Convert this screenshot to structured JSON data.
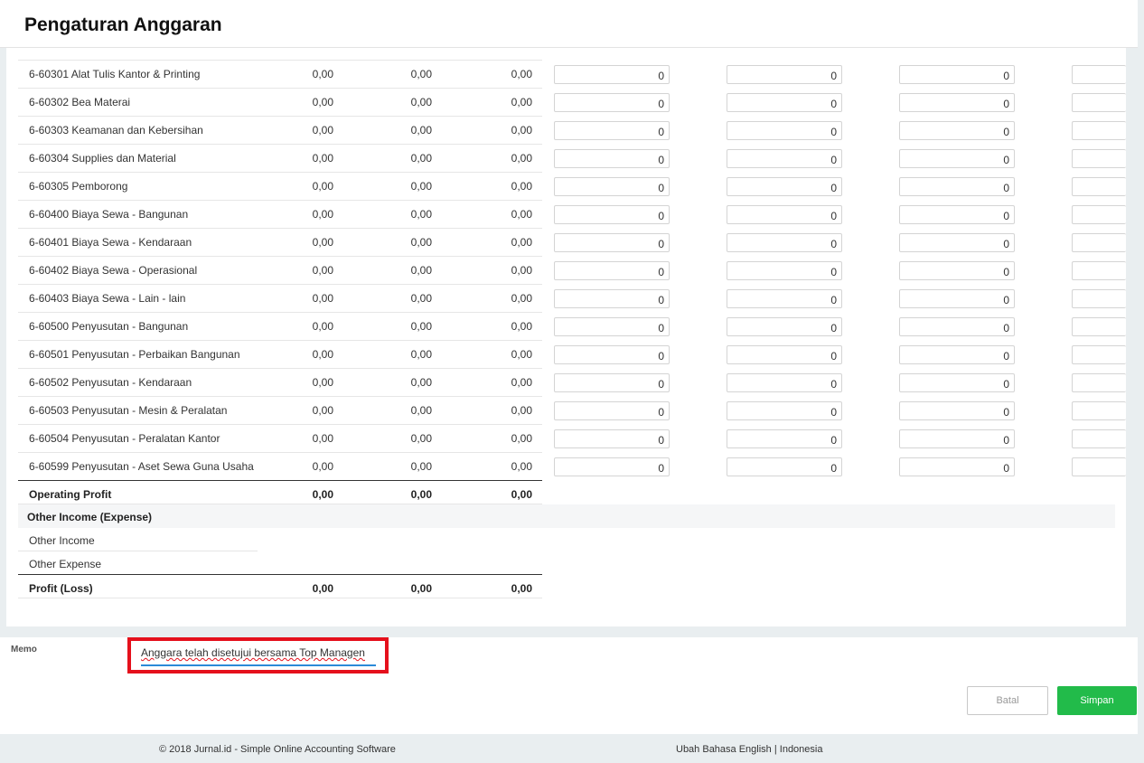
{
  "header": {
    "title": "Pengaturan Anggaran"
  },
  "accounts": [
    {
      "name": "6-60301 Alat Tulis Kantor & Printing",
      "values": [
        "0,00",
        "0,00",
        "0,00"
      ],
      "inputs": [
        "0",
        "0",
        "0"
      ]
    },
    {
      "name": "6-60302 Bea Materai",
      "values": [
        "0,00",
        "0,00",
        "0,00"
      ],
      "inputs": [
        "0",
        "0",
        "0"
      ]
    },
    {
      "name": "6-60303 Keamanan dan Kebersihan",
      "values": [
        "0,00",
        "0,00",
        "0,00"
      ],
      "inputs": [
        "0",
        "0",
        "0"
      ]
    },
    {
      "name": "6-60304 Supplies dan Material",
      "values": [
        "0,00",
        "0,00",
        "0,00"
      ],
      "inputs": [
        "0",
        "0",
        "0"
      ]
    },
    {
      "name": "6-60305 Pemborong",
      "values": [
        "0,00",
        "0,00",
        "0,00"
      ],
      "inputs": [
        "0",
        "0",
        "0"
      ]
    },
    {
      "name": "6-60400 Biaya Sewa - Bangunan",
      "values": [
        "0,00",
        "0,00",
        "0,00"
      ],
      "inputs": [
        "0",
        "0",
        "0"
      ]
    },
    {
      "name": "6-60401 Biaya Sewa - Kendaraan",
      "values": [
        "0,00",
        "0,00",
        "0,00"
      ],
      "inputs": [
        "0",
        "0",
        "0"
      ]
    },
    {
      "name": "6-60402 Biaya Sewa - Operasional",
      "values": [
        "0,00",
        "0,00",
        "0,00"
      ],
      "inputs": [
        "0",
        "0",
        "0"
      ]
    },
    {
      "name": "6-60403 Biaya Sewa - Lain - lain",
      "values": [
        "0,00",
        "0,00",
        "0,00"
      ],
      "inputs": [
        "0",
        "0",
        "0"
      ]
    },
    {
      "name": "6-60500 Penyusutan - Bangunan",
      "values": [
        "0,00",
        "0,00",
        "0,00"
      ],
      "inputs": [
        "0",
        "0",
        "0"
      ]
    },
    {
      "name": "6-60501 Penyusutan - Perbaikan Bangunan",
      "values": [
        "0,00",
        "0,00",
        "0,00"
      ],
      "inputs": [
        "0",
        "0",
        "0"
      ]
    },
    {
      "name": "6-60502 Penyusutan - Kendaraan",
      "values": [
        "0,00",
        "0,00",
        "0,00"
      ],
      "inputs": [
        "0",
        "0",
        "0"
      ]
    },
    {
      "name": "6-60503 Penyusutan - Mesin & Peralatan",
      "values": [
        "0,00",
        "0,00",
        "0,00"
      ],
      "inputs": [
        "0",
        "0",
        "0"
      ]
    },
    {
      "name": "6-60504 Penyusutan - Peralatan Kantor",
      "values": [
        "0,00",
        "0,00",
        "0,00"
      ],
      "inputs": [
        "0",
        "0",
        "0"
      ]
    },
    {
      "name": "6-60599 Penyusutan - Aset Sewa Guna Usaha",
      "values": [
        "0,00",
        "0,00",
        "0,00"
      ],
      "inputs": [
        "0",
        "0",
        "0"
      ]
    }
  ],
  "partial_inputs": [
    "0",
    "0",
    "0"
  ],
  "operating_profit": {
    "label": "Operating Profit",
    "values": [
      "0,00",
      "0,00",
      "0,00"
    ]
  },
  "other_section": {
    "label": "Other Income (Expense)",
    "income_label": "Other Income",
    "expense_label": "Other Expense"
  },
  "profit_loss": {
    "label": "Profit (Loss)",
    "values": [
      "0,00",
      "0,00",
      "0,00"
    ]
  },
  "memo": {
    "label": "Memo",
    "value": "Anggara telah disetujui bersama Top Managen"
  },
  "buttons": {
    "cancel": "Batal",
    "save": "Simpan"
  },
  "footer": {
    "copyright": "© 2018 Jurnal.id - Simple Online Accounting Software",
    "language": "Ubah Bahasa English | Indonesia"
  }
}
